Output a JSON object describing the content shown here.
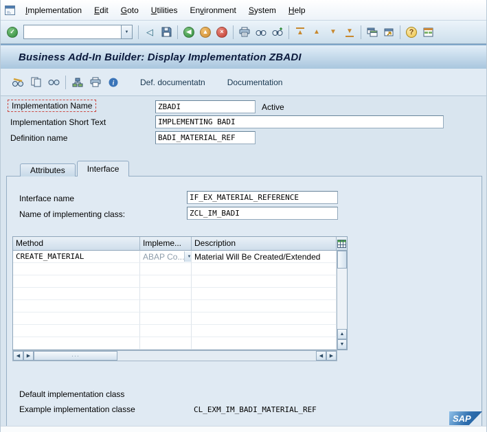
{
  "menu_bar": {
    "items": [
      {
        "label": "Implementation"
      },
      {
        "label": "Edit"
      },
      {
        "label": "Goto"
      },
      {
        "label": "Utilities"
      },
      {
        "label": "Environment"
      },
      {
        "label": "System"
      },
      {
        "label": "Help"
      }
    ]
  },
  "toolbar": {
    "command_field_value": "",
    "icons": [
      "enter-icon",
      "command-dropdown-icon",
      "back-arrow-icon",
      "save-icon",
      "nav-back-icon",
      "nav-exit-icon",
      "nav-cancel-icon",
      "print-icon",
      "find-icon",
      "find-next-icon",
      "first-page-icon",
      "page-up-icon",
      "page-down-icon",
      "last-page-icon",
      "new-session-icon",
      "create-shortcut-icon",
      "help-icon",
      "customize-layout-icon"
    ]
  },
  "title_bar": {
    "title": "Business Add-In Builder: Display Implementation ZBADI"
  },
  "app_toolbar": {
    "icons": [
      "display-change-icon",
      "copy-icon",
      "display-object-icon",
      "hierarchy-icon",
      "print-preview-icon",
      "info-icon"
    ],
    "buttons": [
      {
        "label": "Def. documentatn"
      },
      {
        "label": "Documentation"
      }
    ]
  },
  "form": {
    "implementation_name": {
      "label": "Implementation Name",
      "value": "ZBADI"
    },
    "status_text": "Active",
    "short_text": {
      "label": "Implementation Short Text",
      "value": "IMPLEMENTING BADI"
    },
    "definition_name": {
      "label": "Definition name",
      "value": "BADI_MATERIAL_REF"
    }
  },
  "tabs": {
    "attributes_label": "Attributes",
    "interface_label": "Interface"
  },
  "interface_tab": {
    "interface_name": {
      "label": "Interface name",
      "value": "IF_EX_MATERIAL_REFERENCE"
    },
    "implementing_class": {
      "label": "Name of implementing class:",
      "value": "ZCL_IM_BADI"
    }
  },
  "method_table": {
    "columns": [
      {
        "label": "Method"
      },
      {
        "label": "Impleme..."
      },
      {
        "label": "Description"
      }
    ],
    "rows": [
      {
        "method": "CREATE_MATERIAL",
        "implementation_type": "ABAP Co...",
        "description": "Material Will Be Created/Extended"
      }
    ]
  },
  "footer": {
    "default_class_label": "Default implementation class",
    "example_class_label": "Example implementation classe",
    "example_class_value": "CL_EXM_IM_BADI_MATERIAL_REF"
  },
  "branding": {
    "logo_text": "SAP"
  }
}
